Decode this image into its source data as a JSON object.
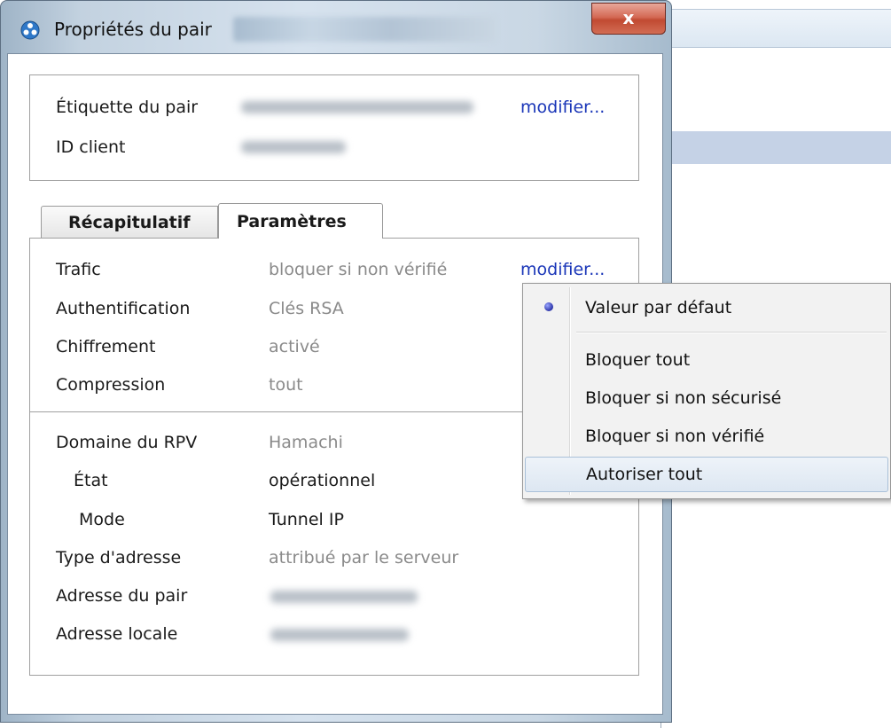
{
  "window": {
    "title": "Propriétés du pair",
    "close_label": "x"
  },
  "peer": {
    "label_title": "Étiquette du pair",
    "client_id_title": "ID client",
    "modify_link": "modifier..."
  },
  "tabs": [
    {
      "label": "Récapitulatif",
      "active": false
    },
    {
      "label": "Paramètres",
      "active": true
    }
  ],
  "settings": {
    "traffic": {
      "label": "Trafic",
      "value": "bloquer si non vérifié",
      "link": "modifier..."
    },
    "auth": {
      "label": "Authentification",
      "value": "Clés RSA"
    },
    "encryption": {
      "label": "Chiffrement",
      "value": "activé"
    },
    "compression": {
      "label": "Compression",
      "value": "tout"
    }
  },
  "network": {
    "vpn_domain": {
      "label": "Domaine du RPV",
      "value": "Hamachi"
    },
    "state": {
      "label": "État",
      "value": "opérationnel"
    },
    "mode": {
      "label": "Mode",
      "value": "Tunnel IP"
    },
    "address_type": {
      "label": "Type d'adresse",
      "value": "attribué par le serveur"
    },
    "peer_address": {
      "label": "Adresse du pair"
    },
    "local_address": {
      "label": "Adresse locale"
    }
  },
  "menu": {
    "items": [
      {
        "label": "Valeur par défaut",
        "selected": true
      },
      {
        "label": "Bloquer tout"
      },
      {
        "label": "Bloquer si non sécurisé"
      },
      {
        "label": "Bloquer si non vérifié"
      },
      {
        "label": "Autoriser tout",
        "hover": true
      }
    ]
  },
  "colors": {
    "link": "#1a36b8",
    "muted_value": "#8a8a8a",
    "close_button": "#c14a32"
  }
}
